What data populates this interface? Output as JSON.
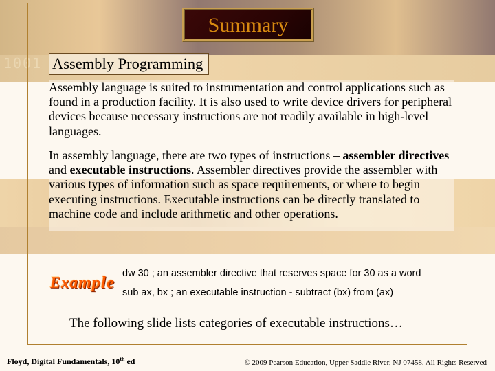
{
  "title": "Summary",
  "section": "Assembly Programming",
  "para1": "Assembly language is suited to instrumentation and control applications such as found in a production facility. It is also used to write device drivers for peripheral devices because necessary instructions are not readily available in high-level languages.",
  "para2_pre": "In assembly language, there are two types of instructions – ",
  "para2_b1": "assembler directives",
  "para2_mid": " and ",
  "para2_b2": "executable instructions",
  "para2_post": ". Assembler directives provide the assembler with various types of information such as space requirements, or where to begin executing instructions. Executable instructions can be directly translated to machine code and include arithmetic and other operations.",
  "example_label": "Example",
  "ex_line1": "dw 30 ; an assembler directive that reserves space for 30 as a word",
  "ex_line2": "sub ax, bx ; an executable instruction - subtract (bx) from (ax)",
  "follow": "The following slide lists categories of executable instructions…",
  "footer_left_a": "Floyd, Digital Fundamentals, 10",
  "footer_left_sup": "th",
  "footer_left_b": " ed",
  "footer_right": "© 2009 Pearson Education, Upper Saddle River, NJ 07458. All Rights Reserved"
}
